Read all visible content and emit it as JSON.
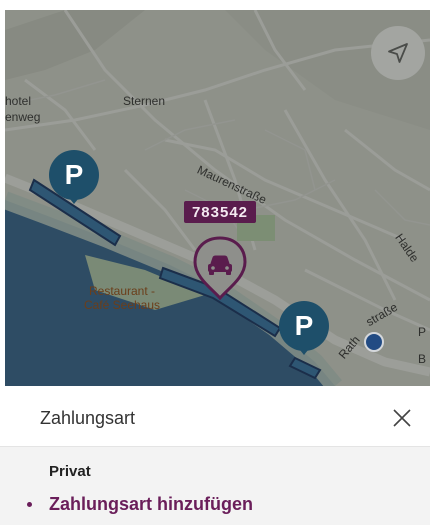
{
  "map": {
    "labels": {
      "hotel": "hotel",
      "enweg": "enweg",
      "sternen": "Sternen",
      "maurenstrasse": "Maurenstraße",
      "halde": "Halde",
      "rathstrasse_a": "Rath",
      "rathstrasse_b": "straße",
      "poi_line1": "Restaurant -",
      "poi_line2": "Café Seehaus",
      "edge_p": "P",
      "edge_b": "B"
    },
    "parking_marker_text": "P",
    "zone_number": "783542",
    "colors": {
      "parking": "#1e4f6a",
      "accent": "#6a1e5a",
      "water": "#2e4c64",
      "location": "#224b83"
    },
    "icons": {
      "locate": "navigation-arrow-icon",
      "vehicle": "car-icon",
      "close": "close-icon"
    }
  },
  "sheet": {
    "title": "Zahlungsart",
    "section_label": "Privat",
    "add_payment_label": "Zahlungsart hinzufügen"
  }
}
